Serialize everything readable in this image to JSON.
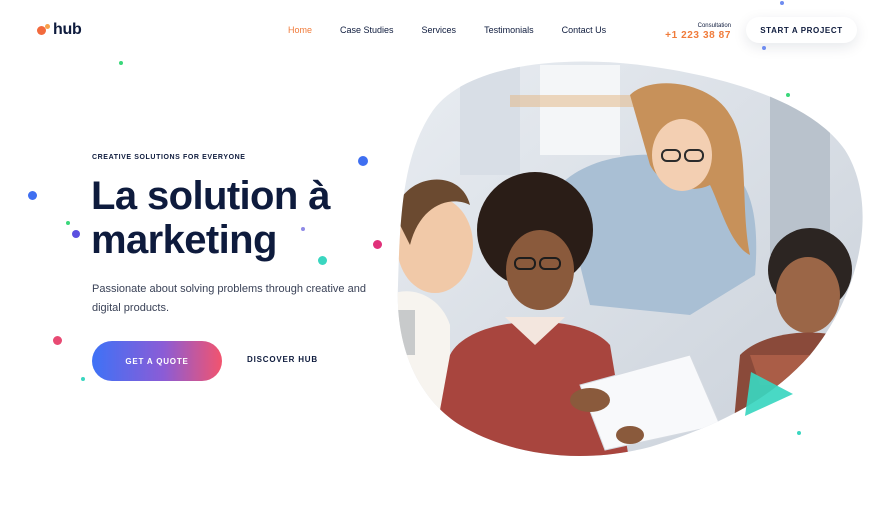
{
  "brand": {
    "name": "hub",
    "colors": {
      "primary": "#0e1b3d",
      "accent": "#f07b3a"
    }
  },
  "nav": {
    "items": [
      {
        "label": "Home",
        "active": true
      },
      {
        "label": "Case Studies",
        "active": false
      },
      {
        "label": "Services",
        "active": false
      },
      {
        "label": "Testimonials",
        "active": false
      },
      {
        "label": "Contact Us",
        "active": false
      }
    ]
  },
  "consultation": {
    "label": "Consultation",
    "phone": "+1 223 38 87"
  },
  "header": {
    "cta_label": "START A PROJECT"
  },
  "hero": {
    "eyebrow": "CREATIVE SOLUTIONS FOR EVERYONE",
    "headline_line1": "La solution à",
    "headline_line2": "marketing",
    "subtext": "Passionate about solving problems through creative and digital products.",
    "primary_cta": "GET A QUOTE",
    "secondary_cta": "DISCOVER HUB",
    "image": {
      "subject": "four-people-reviewing-document-photo"
    }
  },
  "decor": {
    "icons": [
      "play-triangle-icon"
    ]
  }
}
